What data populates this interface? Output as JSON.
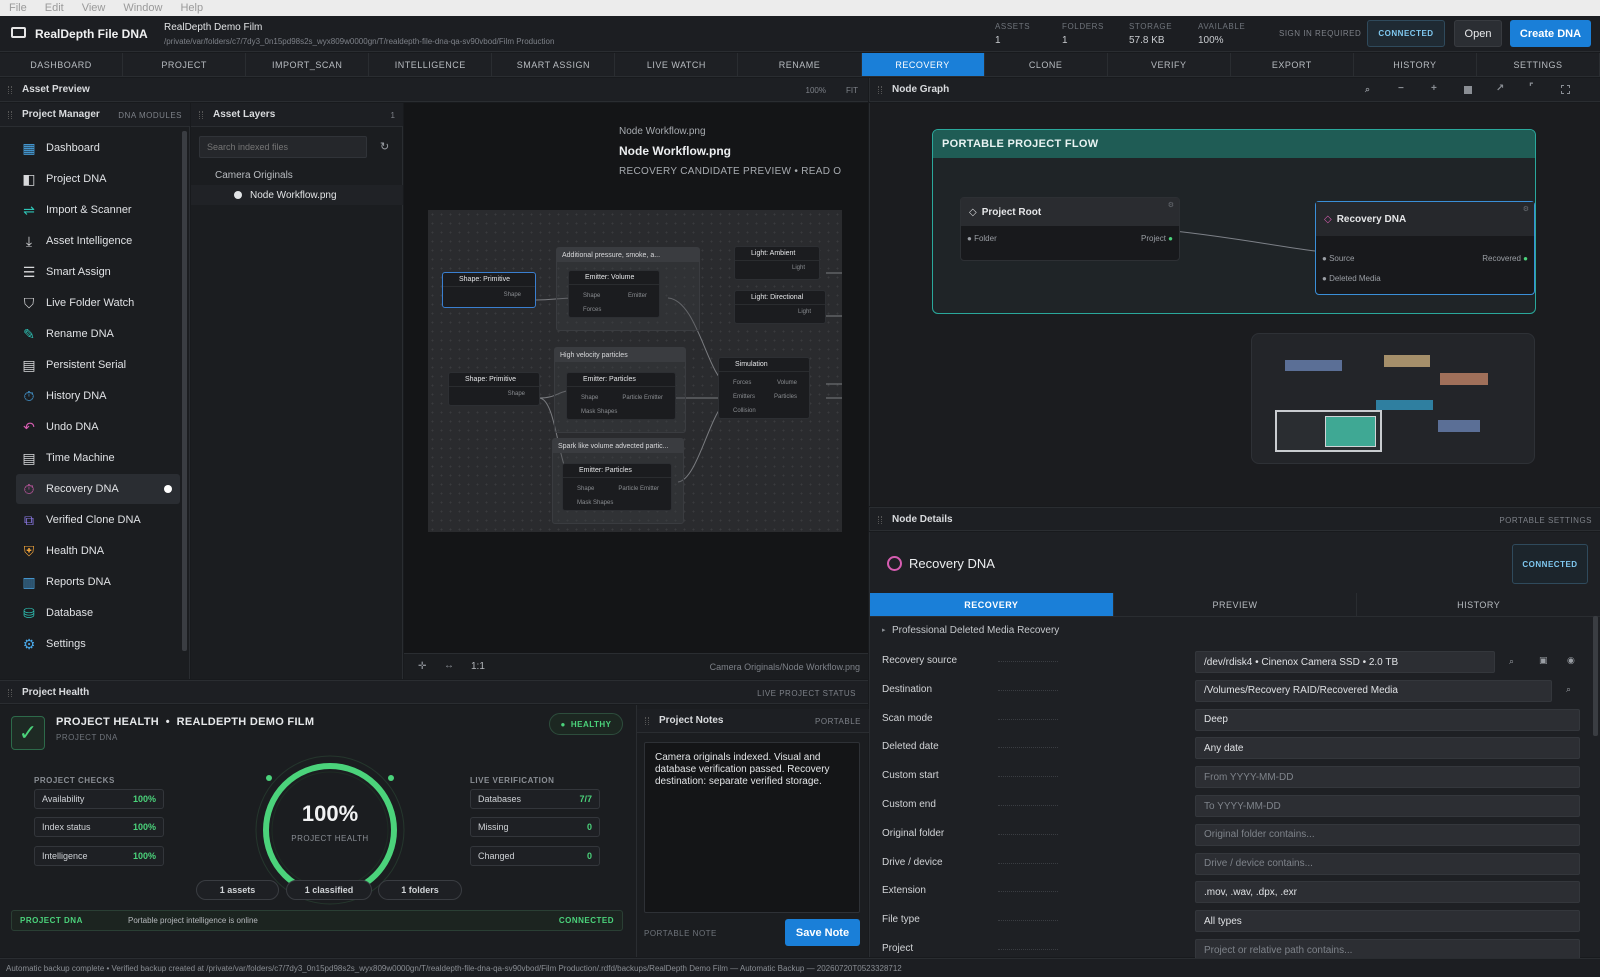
{
  "menu": [
    "File",
    "Edit",
    "View",
    "Window",
    "Help"
  ],
  "app": {
    "title": "RealDepth File DNA",
    "project_name": "RealDepth Demo Film",
    "project_path": "/private/var/folders/c7/7dy3_0n15pd98s2s_wyx809w0000gn/T/realdepth-file-dna-qa-sv90vbod/Film Production"
  },
  "stats": [
    {
      "label": "ASSETS",
      "value": "1"
    },
    {
      "label": "FOLDERS",
      "value": "1"
    },
    {
      "label": "STORAGE",
      "value": "57.8 KB"
    },
    {
      "label": "AVAILABLE",
      "value": "100%"
    }
  ],
  "topbar": {
    "sign_in": "SIGN IN REQUIRED",
    "connected": "CONNECTED",
    "open": "Open",
    "create": "Create DNA"
  },
  "tabs": [
    "DASHBOARD",
    "PROJECT",
    "IMPORT_SCAN",
    "INTELLIGENCE",
    "SMART ASSIGN",
    "LIVE WATCH",
    "RENAME",
    "RECOVERY",
    "CLONE",
    "VERIFY",
    "EXPORT",
    "HISTORY",
    "SETTINGS"
  ],
  "asset_preview": {
    "title": "Asset Preview",
    "zoom": "100%",
    "fit": "FIT"
  },
  "project_manager": {
    "title": "Project Manager",
    "modules": "DNA MODULES",
    "items": [
      "Dashboard",
      "Project DNA",
      "Import & Scanner",
      "Asset Intelligence",
      "Smart Assign",
      "Live Folder Watch",
      "Rename DNA",
      "Persistent Serial",
      "History DNA",
      "Undo DNA",
      "Time Machine",
      "Recovery DNA",
      "Verified Clone DNA",
      "Health DNA",
      "Reports DNA",
      "Database",
      "Settings"
    ],
    "colors": {
      "accent": "#1a7fd8",
      "teal": "#2ec4b6",
      "pink": "#d65db1",
      "orange": "#f0a33a"
    }
  },
  "asset_layers": {
    "title": "Asset Layers",
    "count": "1",
    "search_placeholder": "Search indexed files",
    "folder": "Camera Originals",
    "file": "Node Workflow.png"
  },
  "preview": {
    "file_small": "Node Workflow.png",
    "file_big": "Node Workflow.png",
    "caption": "RECOVERY CANDIDATE PREVIEW • READ O",
    "ratio": "1:1",
    "path": "Camera Originals/Node Workflow.png",
    "workflow": {
      "groups": [
        "Additional pressure, smoke, a...",
        "High velocity particles",
        "Spark like volume advected partic..."
      ],
      "nodes": {
        "shape1": {
          "title": "Shape: Primitive",
          "port": "Shape"
        },
        "emitter_vol": {
          "title": "Emitter: Volume",
          "in1": "Shape",
          "in2": "Forces",
          "out": "Emitter"
        },
        "light_amb": {
          "title": "Light: Ambient",
          "out": "Light"
        },
        "light_dir": {
          "title": "Light: Directional",
          "out": "Light"
        },
        "shape2": {
          "title": "Shape: Primitive",
          "port": "Shape"
        },
        "emitter_p1": {
          "title": "Emitter: Particles",
          "in1": "Shape",
          "in2": "Mask Shapes",
          "out": "Particle Emitter"
        },
        "simulation": {
          "title": "Simulation",
          "in1": "Forces",
          "in2": "Emitters",
          "in3": "Collision",
          "out1": "Volume",
          "out2": "Particles"
        },
        "emitter_p2": {
          "title": "Emitter: Particles",
          "in1": "Shape",
          "in2": "Mask Shapes",
          "out": "Particle Emitter"
        }
      }
    }
  },
  "node_graph": {
    "title": "Node Graph",
    "flow_title": "PORTABLE PROJECT FLOW",
    "root": {
      "title": "Project Root",
      "in": "Folder",
      "out": "Project"
    },
    "recovery": {
      "title": "Recovery DNA",
      "in1": "Source",
      "in2": "Deleted Media",
      "out": "Recovered"
    }
  },
  "node_details": {
    "title": "Node Details",
    "settings": "PORTABLE SETTINGS",
    "node_name": "Recovery DNA",
    "status": "CONNECTED",
    "tabs": [
      "RECOVERY",
      "PREVIEW",
      "HISTORY"
    ],
    "section": "Professional Deleted Media Recovery",
    "rows": [
      {
        "label": "Recovery source",
        "value": "/dev/rdisk4 • Cinenox Camera SSD • 2.0 TB",
        "ph": false
      },
      {
        "label": "Destination",
        "value": "/Volumes/Recovery RAID/Recovered Media",
        "ph": false
      },
      {
        "label": "Scan mode",
        "value": "Deep",
        "ph": false
      },
      {
        "label": "Deleted date",
        "value": "Any date",
        "ph": false
      },
      {
        "label": "Custom start",
        "value": "From YYYY-MM-DD",
        "ph": true
      },
      {
        "label": "Custom end",
        "value": "To YYYY-MM-DD",
        "ph": true
      },
      {
        "label": "Original folder",
        "value": "Original folder contains...",
        "ph": true
      },
      {
        "label": "Drive / device",
        "value": "Drive / device contains...",
        "ph": true
      },
      {
        "label": "Extension",
        "value": ".mov, .wav, .dpx, .exr",
        "ph": false
      },
      {
        "label": "File type",
        "value": "All types",
        "ph": false
      },
      {
        "label": "Project",
        "value": "Project or relative path contains...",
        "ph": true
      }
    ]
  },
  "project_health": {
    "title": "Project Health",
    "live_status": "LIVE PROJECT STATUS",
    "headline": "PROJECT HEALTH",
    "project": "REALDEPTH DEMO FILM",
    "sub": "PROJECT DNA",
    "badge": "HEALTHY",
    "checks_title": "PROJECT CHECKS",
    "checks": [
      {
        "label": "Availability",
        "value": "100%"
      },
      {
        "label": "Index status",
        "value": "100%"
      },
      {
        "label": "Intelligence",
        "value": "100%"
      }
    ],
    "gauge_value": "100%",
    "gauge_label": "PROJECT HEALTH",
    "live_title": "LIVE VERIFICATION",
    "live": [
      {
        "label": "Databases",
        "value": "7/7"
      },
      {
        "label": "Missing",
        "value": "0"
      },
      {
        "label": "Changed",
        "value": "0"
      }
    ],
    "pills": [
      "1 assets",
      "1 classified",
      "1 folders"
    ],
    "footer_left": "PROJECT DNA",
    "footer_text": "Portable project intelligence is online",
    "footer_right": "CONNECTED"
  },
  "notes": {
    "title": "Project Notes",
    "tag": "PORTABLE",
    "text": "Camera originals indexed. Visual and database verification passed. Recovery destination: separate verified storage.",
    "footer": "PORTABLE NOTE",
    "save": "Save Note"
  },
  "statusbar": "Automatic backup complete  •  Verified backup created at /private/var/folders/c7/7dy3_0n15pd98s2s_wyx809w0000gn/T/realdepth-file-dna-qa-sv90vbod/Film Production/.rdfd/backups/RealDepth Demo Film — Automatic Backup — 20260720T0523328712"
}
